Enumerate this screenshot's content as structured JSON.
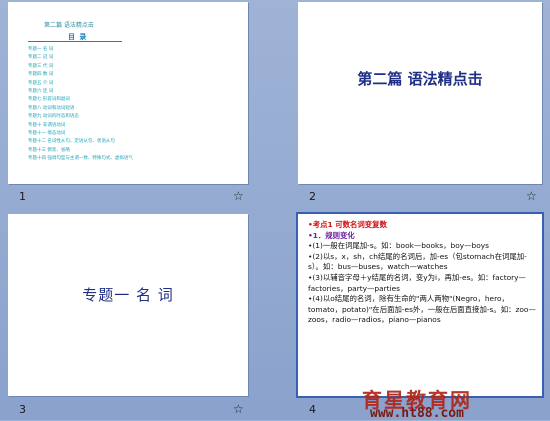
{
  "slides": [
    {
      "number": "1",
      "header_line": "第二篇  语法精点击",
      "toc_title": "目  录",
      "toc_items": [
        "专题一  名  词",
        "专题二  冠  词",
        "专题三  代  词",
        "专题四  数  词",
        "专题五  介  词",
        "专题六  连  词",
        "专题七  形容词和副词",
        "专题八  动词和动词短语",
        "专题九  动词的时态和语态",
        "专题十  非谓语动词",
        "专题十一  情态动词",
        "专题十二  名词性从句、定语从句、状语从句",
        "专题十三  倒装、省略",
        "专题十四  强调句型与主谓一致、特殊句式、虚拟语气"
      ]
    },
    {
      "number": "2",
      "title": "第二篇    语法精点击"
    },
    {
      "number": "3",
      "title": "专题一   名   词"
    },
    {
      "number": "4",
      "heading": "•考点1  可数名词变复数",
      "subheading": "•1．规则变化",
      "points": [
        "•(1)一般在词尾加-s。如：book—books，boy—boys",
        "•(2)以s，x，sh，ch结尾的名词后，加-es（包stomach在词尾加-s）。如：bus—buses，watch—watches",
        "•(3)以辅音字母＋y结尾的名词，变y为i，再加-es。如：factory—factories，party—parties",
        "•(4)以o结尾的名词，除有生命的\"两人两物\"(Negro，hero，tomato，potato)\"在后面加-es外，一般在后面直接加-s。如：zoo—zoos，radio—radios，piano—pianos"
      ]
    }
  ],
  "slide_icon": "transition-star-icon",
  "watermark": {
    "chinese": "育星教育网",
    "url": "www.ht88.com"
  }
}
